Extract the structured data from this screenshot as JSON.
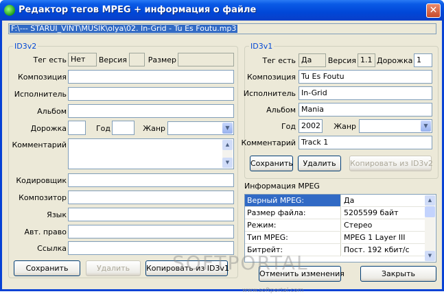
{
  "window": {
    "title": "Редактор тегов MPEG + информация о файле",
    "close": "✕"
  },
  "file_path": "F:\\---   STARUI_VINT\\MUSIK\\olya\\02. In-Grid - Tu Es Foutu.mp3",
  "id3v2": {
    "legend": "ID3v2",
    "tag_label": "Тег есть",
    "tag_value": "Нет",
    "version_label": "Версия",
    "version_value": "",
    "size_label": "Размер",
    "size_value": "",
    "composition_label": "Композиция",
    "composition_value": "",
    "artist_label": "Исполнитель",
    "artist_value": "",
    "album_label": "Альбом",
    "album_value": "",
    "track_label": "Дорожка",
    "track_value": "",
    "year_label": "Год",
    "year_value": "",
    "genre_label": "Жанр",
    "genre_value": "",
    "comment_label": "Комментарий",
    "comment_value": "",
    "encoder_label": "Кодировщик",
    "encoder_value": "",
    "composer_label": "Композитор",
    "composer_value": "",
    "language_label": "Язык",
    "language_value": "",
    "copyright_label": "Авт. право",
    "copyright_value": "",
    "link_label": "Ссылка",
    "link_value": "",
    "save_button": "Сохранить",
    "delete_button": "Удалить",
    "copy_button": "Копировать из ID3v1"
  },
  "id3v1": {
    "legend": "ID3v1",
    "tag_label": "Тег есть",
    "tag_value": "Да",
    "version_label": "Версия",
    "version_value": "1.1",
    "track_label": "Дорожка",
    "track_value": "1",
    "composition_label": "Композиция",
    "composition_value": "Tu Es Foutu",
    "artist_label": "Исполнитель",
    "artist_value": "In-Grid",
    "album_label": "Альбом",
    "album_value": "Mania",
    "year_label": "Год",
    "year_value": "2002",
    "genre_label": "Жанр",
    "genre_value": "",
    "comment_label": "Комментарий",
    "comment_value": "Track 1",
    "save_button": "Сохранить",
    "delete_button": "Удалить",
    "copy_button": "Копировать из ID3v2"
  },
  "mpeg_info": {
    "title": "Информация MPEG",
    "rows": [
      {
        "key": "Верный MPEG:",
        "value": "Да"
      },
      {
        "key": "Размер файла:",
        "value": "5205599 байт"
      },
      {
        "key": "Режим:",
        "value": "Стерео"
      },
      {
        "key": "Тип MPEG:",
        "value": "MPEG 1 Layer III"
      },
      {
        "key": "Битрейт:",
        "value": "Пост. 192 кбит/с"
      }
    ]
  },
  "footer": {
    "undo_button": "Отменить изменения",
    "close_button": "Закрыть"
  },
  "watermark": {
    "text": "SOFTPORTAL",
    "url": "www.softportal.com"
  }
}
